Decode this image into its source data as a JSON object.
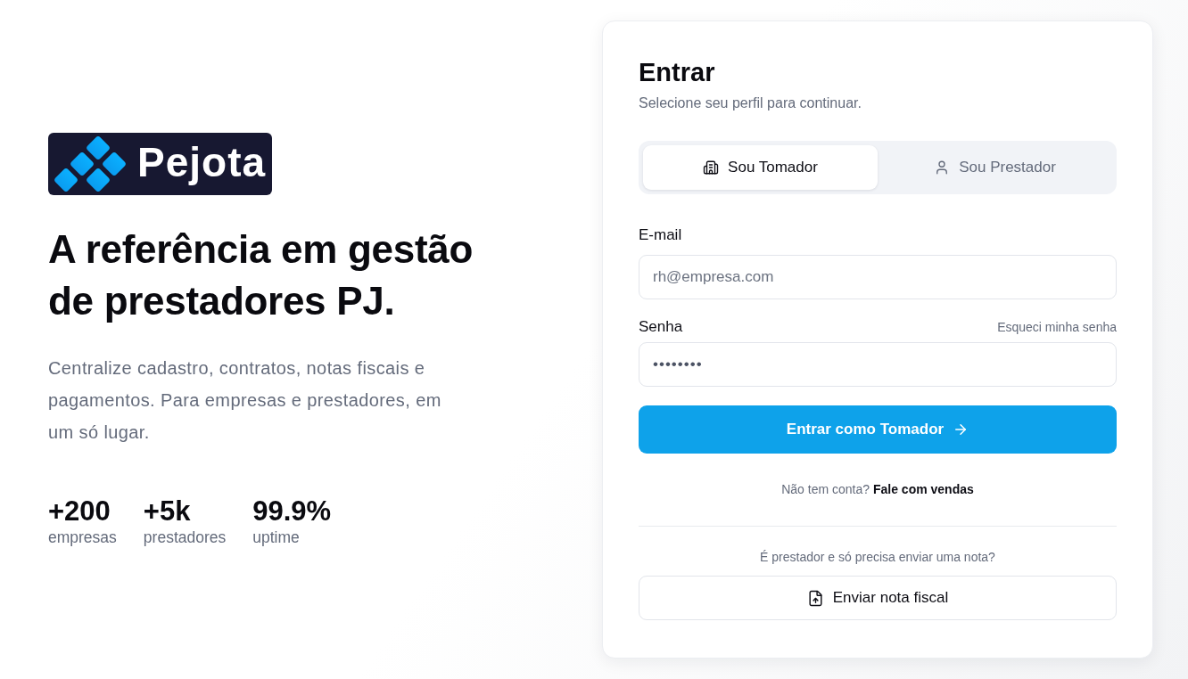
{
  "brand": {
    "name": "Pejota"
  },
  "hero": {
    "headline": "A referência em gestão de prestadores PJ.",
    "description": "Centralize cadastro, contratos, notas fiscais e pagamentos. Para empresas e prestadores, em um só lugar.",
    "stats": [
      {
        "value": "+200",
        "label": "empresas"
      },
      {
        "value": "+5k",
        "label": "prestadores"
      },
      {
        "value": "99.9%",
        "label": "uptime"
      }
    ]
  },
  "login": {
    "title": "Entrar",
    "subtitle": "Selecione seu perfil para continuar.",
    "tabs": [
      {
        "label": "Sou Tomador",
        "kind": "company",
        "selected": true
      },
      {
        "label": "Sou Prestador",
        "kind": "person",
        "selected": false
      }
    ],
    "fields": [
      {
        "label": "E-mail",
        "kind": "email",
        "placeholder": "rh@empresa.com"
      },
      {
        "label": "Senha",
        "kind": "password",
        "value": "••••••••",
        "link": "Esqueci minha senha"
      }
    ],
    "submit": "Entrar como Tomador",
    "signup": {
      "prompt": "Não tem conta?",
      "link": "Fale com vendas"
    },
    "alternative": {
      "prompt": "É prestador e só precisa enviar uma nota?",
      "button": "Enviar nota fiscal"
    }
  }
}
